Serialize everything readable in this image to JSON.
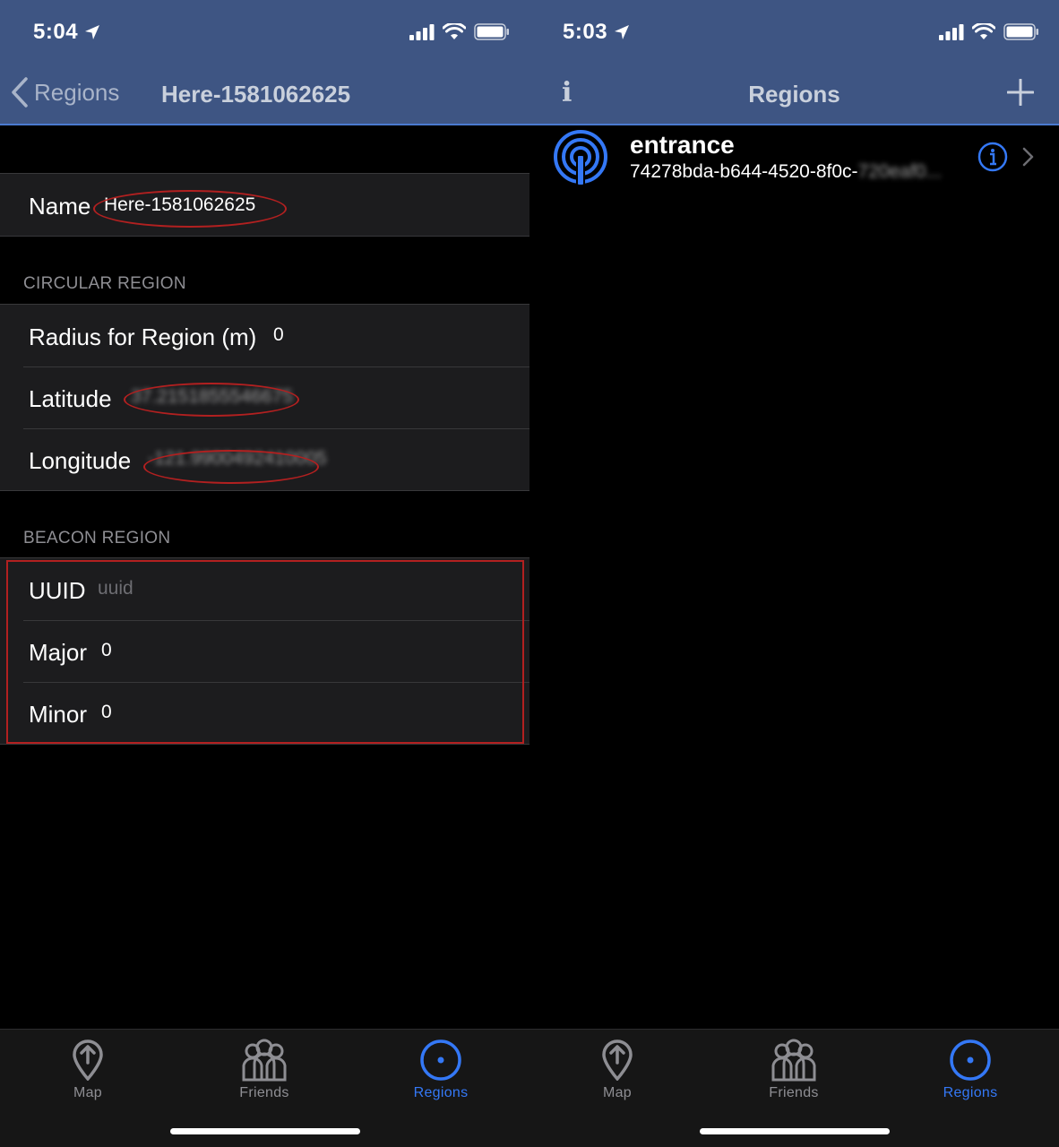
{
  "left": {
    "status": {
      "time": "5:04"
    },
    "nav": {
      "back_label": "Regions",
      "title": "Here-1581062625"
    },
    "name_cell": {
      "label": "Name",
      "value": "Here-1581062625"
    },
    "circular": {
      "header": "CIRCULAR REGION",
      "radius_label": "Radius for Region (m)",
      "radius_value": "0",
      "latitude_label": "Latitude",
      "latitude_value": "37.2151855546675",
      "longitude_label": "Longitude",
      "longitude_value": "-121.9900492410005"
    },
    "beacon": {
      "header": "BEACON REGION",
      "uuid_label": "UUID",
      "uuid_placeholder": "uuid",
      "major_label": "Major",
      "major_value": "0",
      "minor_label": "Minor",
      "minor_value": "0"
    },
    "tabs": [
      {
        "label": "Map",
        "icon": "map-pin-icon"
      },
      {
        "label": "Friends",
        "icon": "friends-icon"
      },
      {
        "label": "Regions",
        "icon": "regions-icon"
      }
    ]
  },
  "right": {
    "status": {
      "time": "5:03"
    },
    "nav": {
      "title": "Regions",
      "info_label": "i"
    },
    "region": {
      "title": "entrance",
      "subtitle_visible": "74278bda-b644-4520-8f0c-",
      "subtitle_hidden": "720eaf0..."
    },
    "tabs": [
      {
        "label": "Map",
        "icon": "map-pin-icon"
      },
      {
        "label": "Friends",
        "icon": "friends-icon"
      },
      {
        "label": "Regions",
        "icon": "regions-icon"
      }
    ]
  },
  "colors": {
    "nav_bg": "#3e5583",
    "accent": "#3478f6",
    "annotation_red": "#b22020",
    "cell_bg": "#1c1c1e"
  }
}
